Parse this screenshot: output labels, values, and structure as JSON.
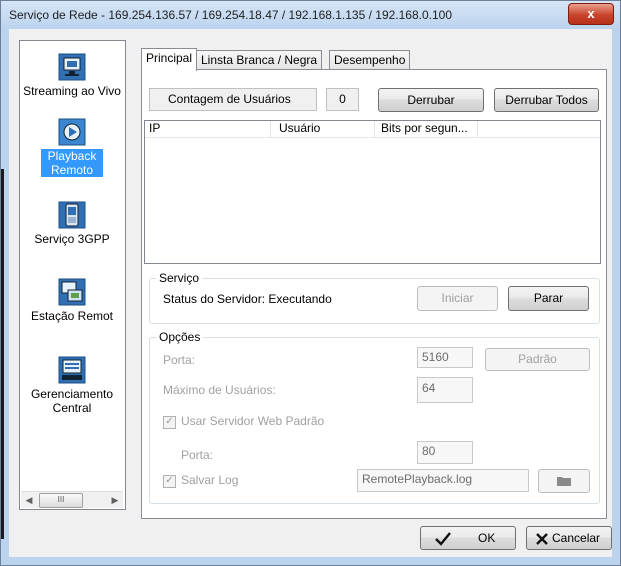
{
  "window": {
    "title": "Serviço de Rede - 169.254.136.57 / 169.254.18.47 / 192.168.1.135 / 192.168.0.100",
    "close_glyph": "x"
  },
  "sidebar": {
    "items": [
      {
        "label": "Streaming ao Vivo",
        "icon": "monitor-stream-icon",
        "selected": false
      },
      {
        "label": "Playback Remoto",
        "icon": "playback-icon",
        "selected": true
      },
      {
        "label": "Serviço 3GPP",
        "icon": "mobile-phone-icon",
        "selected": false
      },
      {
        "label": "Estação Remot",
        "icon": "remote-station-icon",
        "selected": false
      },
      {
        "label": "Gerenciamento Central",
        "icon": "central-management-icon",
        "selected": false
      }
    ],
    "scroll_left": "◀",
    "scroll_right": "▶",
    "scroll_thumb": "III"
  },
  "tabs": [
    {
      "label": "Principal",
      "active": true
    },
    {
      "label": "Linsta Branca / Negra",
      "active": false
    },
    {
      "label": "Desempenho",
      "active": false
    }
  ],
  "principal": {
    "user_count_label": "Contagem de Usuários",
    "user_count_value": "0",
    "kick_button": "Derrubar",
    "kick_all_button": "Derrubar Todos",
    "list_columns": [
      "IP",
      "Usuário",
      "Bits por segun..."
    ],
    "service": {
      "legend": "Serviço",
      "status": "Status do Servidor: Executando",
      "start_button": "Iniciar",
      "stop_button": "Parar"
    },
    "options": {
      "legend": "Opções",
      "port_label": "Porta:",
      "port_value": "5160",
      "default_button": "Padrão",
      "max_users_label": "Máximo de Usuários:",
      "max_users_value": "64",
      "use_web_server_label": "Usar Servidor Web Padrão",
      "use_web_server_checked": true,
      "web_port_label": "Porta:",
      "web_port_value": "80",
      "save_log_label": "Salvar Log",
      "save_log_checked": true,
      "log_file_value": "RemotePlayback.log"
    }
  },
  "footer": {
    "ok_button": "OK",
    "cancel_button": "Cancelar"
  }
}
